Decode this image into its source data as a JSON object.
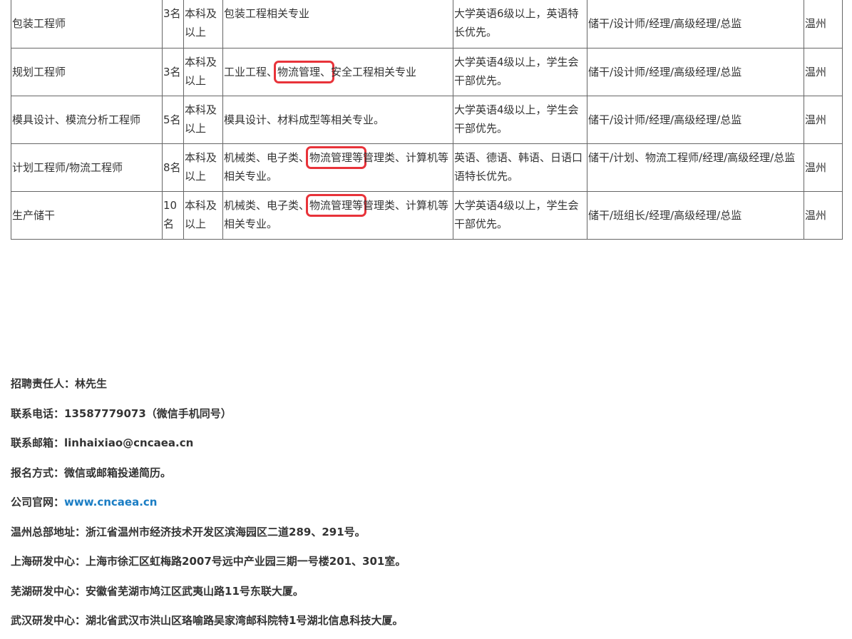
{
  "jobs": [
    {
      "title": "包装工程师",
      "count": "3名",
      "education": "本科及以上",
      "major": {
        "pre": "包装工程相关专业",
        "hl": "",
        "post": ""
      },
      "language": "大学英语6级以上，英语特长优先。",
      "career": "储干/设计师/经理/高级经理/总监",
      "location": "温州"
    },
    {
      "title": "规划工程师",
      "count": "3名",
      "education": "本科及以上",
      "major": {
        "pre": "工业工程、",
        "hl": "物流管理、",
        "post": "安全工程相关专业"
      },
      "language": "大学英语4级以上，学生会干部优先。",
      "career": "储干/设计师/经理/高级经理/总监",
      "location": "温州"
    },
    {
      "title": "模具设计、模流分析工程师",
      "count": "5名",
      "education": "本科及以上",
      "major": {
        "pre": "模具设计、材料成型等相关专业。",
        "hl": "",
        "post": ""
      },
      "language": "大学英语4级以上，学生会干部优先。",
      "career": "储干/设计师/经理/高级经理/总监",
      "location": "温州"
    },
    {
      "title": "计划工程师/物流工程师",
      "count": "8名",
      "education": "本科及以上",
      "major": {
        "pre": "机械类、电子类、",
        "hl": "物流管理等",
        "post": "管理类、计算机等相关专业。"
      },
      "language": "英语、德语、韩语、日语口语特长优先。",
      "career": "储干/计划、物流工程师/经理/高级经理/总监",
      "location": "温州"
    },
    {
      "title": "生产储干",
      "count": "10名",
      "education": "本科及以上",
      "major": {
        "pre": "机械类、电子类、",
        "hl": "物流管理等",
        "post": "管理类、计算机等相关专业。"
      },
      "language": "大学英语4级以上，学生会干部优先。",
      "career": "储干/班组长/经理/高级经理/总监",
      "location": "温州"
    }
  ],
  "contact": {
    "recruiter": "招聘责任人：林先生",
    "phone": "联系电话：13587779073（微信手机同号）",
    "email": "联系邮箱：linhaixiao@cncaea.cn",
    "apply": "报名方式：微信或邮箱投递简历。",
    "website_label": "公司官网：",
    "website_link": "www.cncaea.cn",
    "hq_address": "温州总部地址：浙江省温州市经济技术开发区滨海园区二道289、291号。",
    "shanghai": "上海研发中心：上海市徐汇区虹梅路2007号远中产业园三期一号楼201、301室。",
    "wuhu": "芜湖研发中心：安徽省芜湖市鸠江区武夷山路11号东联大厦。",
    "wuhan": "武汉研发中心：湖北省武汉市洪山区珞喻路吴家湾邮科院特1号湖北信息科技大厦。"
  }
}
